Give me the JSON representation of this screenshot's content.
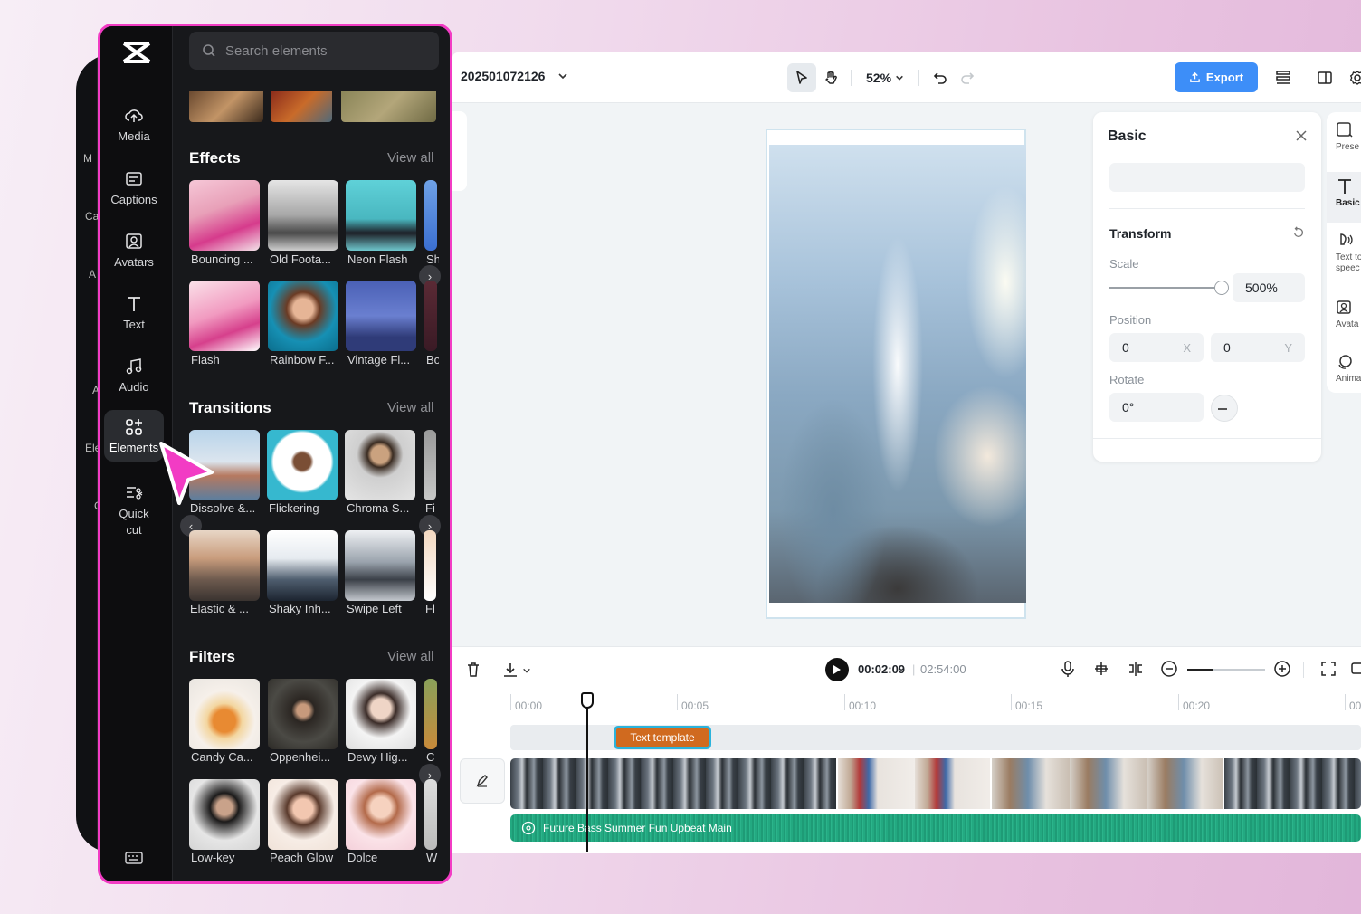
{
  "editor": {
    "project_title": "202501072126",
    "zoom": "52%",
    "export_label": "Export",
    "colors": {
      "accent": "#3d8ef8",
      "highlight": "#f23cc4",
      "audio": "#23a981",
      "text_clip": "#d06a1f"
    }
  },
  "props": {
    "title": "Basic",
    "transform_label": "Transform",
    "scale_label": "Scale",
    "scale_value": "500%",
    "position_label": "Position",
    "pos_x": "0",
    "pos_x_axis": "X",
    "pos_y": "0",
    "pos_y_axis": "Y",
    "rotate_label": "Rotate",
    "rotate_value": "0°"
  },
  "rail": {
    "items": [
      {
        "label": "Prese",
        "icon": "presets-icon"
      },
      {
        "label": "Basic",
        "icon": "text-icon"
      },
      {
        "label": "Text to speec",
        "icon": "text-to-speech-icon"
      },
      {
        "label": "Avata",
        "icon": "avatar-icon"
      },
      {
        "label": "Anima",
        "icon": "animation-icon"
      }
    ]
  },
  "timeline": {
    "current_time": "00:02:09",
    "total_time": "02:54:00",
    "ruler": [
      "00:00",
      "00:05",
      "00:10",
      "00:15",
      "00:20",
      "00"
    ],
    "text_clip": "Text template",
    "audio_clip": "Future Bass Summer Fun Upbeat Main"
  },
  "ghost": {
    "labels": [
      "M",
      "Ca",
      "A",
      "A",
      "Ele",
      "C"
    ]
  },
  "sidebar": {
    "nav": [
      {
        "label": "Media",
        "icon": "cloud-upload-icon"
      },
      {
        "label": "Captions",
        "icon": "captions-icon"
      },
      {
        "label": "Avatars",
        "icon": "avatar-icon"
      },
      {
        "label": "Text",
        "icon": "text-icon"
      },
      {
        "label": "Audio",
        "icon": "music-note-icon"
      },
      {
        "label": "Elements",
        "icon": "elements-icon"
      },
      {
        "label": "Quick cut",
        "icon": "quick-cut-icon"
      }
    ],
    "search_placeholder": "Search elements",
    "view_all": "View all",
    "effects": {
      "title": "Effects",
      "row1": [
        "Bouncing ...",
        "Old Foota...",
        "Neon Flash",
        "Sh"
      ],
      "row2": [
        "Flash",
        "Rainbow F...",
        "Vintage Fl...",
        "Bo"
      ]
    },
    "transitions": {
      "title": "Transitions",
      "row1": [
        "Dissolve &...",
        "Flickering",
        "Chroma S...",
        "Fi"
      ],
      "row2": [
        "Elastic & ...",
        "Shaky Inh...",
        "Swipe Left",
        "Fl"
      ]
    },
    "filters": {
      "title": "Filters",
      "row1": [
        "Candy Ca...",
        "Oppenhei...",
        "Dewy Hig...",
        "C"
      ],
      "row2": [
        "Low-key",
        "Peach Glow",
        "Dolce",
        "W"
      ]
    }
  }
}
